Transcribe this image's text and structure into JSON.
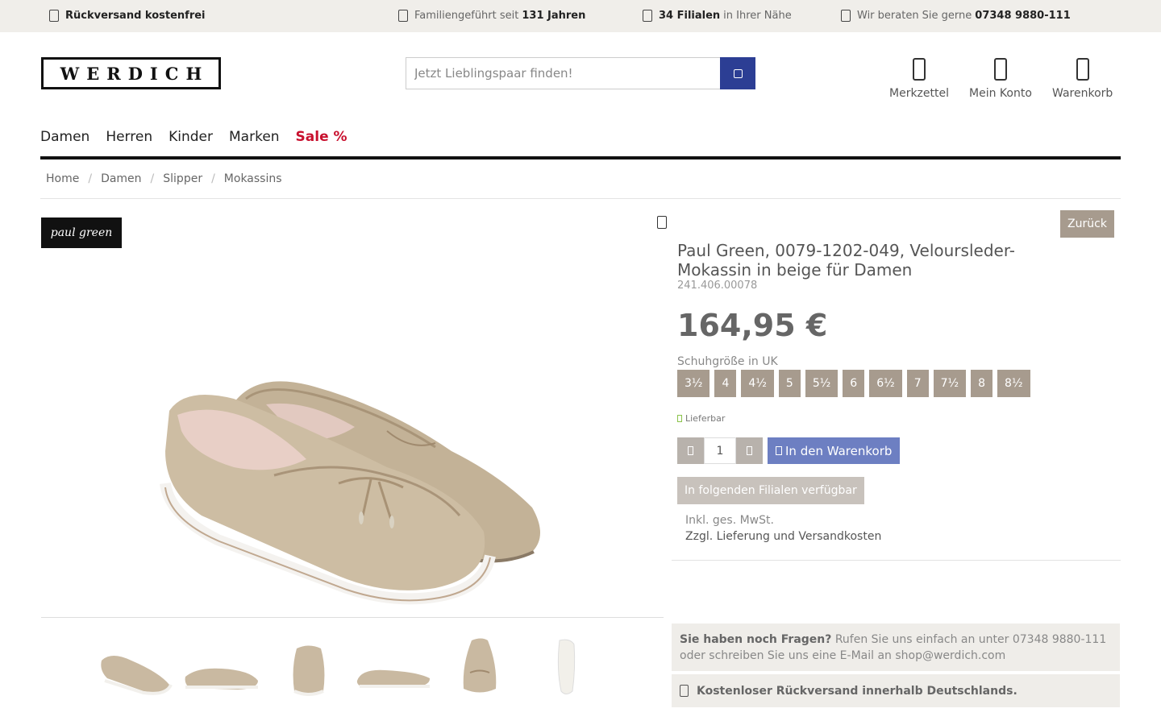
{
  "topbar": {
    "items": [
      {
        "icon": "box-icon",
        "pre": "",
        "bold": "Rückversand kostenfrei",
        "post": ""
      },
      {
        "icon": "home-icon",
        "pre": "Familiengeführt seit ",
        "bold": "131 Jahren",
        "post": ""
      },
      {
        "icon": "map-pin-icon",
        "pre": "",
        "bold": "34 Filialen",
        "post": " in Ihrer Nähe"
      },
      {
        "icon": "phone-icon",
        "pre": "Wir beraten Sie gerne ",
        "bold": "07348 9880-111",
        "post": ""
      }
    ]
  },
  "header": {
    "logo": "WERDICH",
    "search_placeholder": "Jetzt Lieblingspaar finden!",
    "icons": [
      {
        "name": "merkzettel",
        "label": "Merkzettel",
        "icon": "heart-icon"
      },
      {
        "name": "mein-konto",
        "label": "Mein Konto",
        "icon": "user-icon"
      },
      {
        "name": "warenkorb",
        "label": "Warenkorb",
        "icon": "cart-icon"
      }
    ]
  },
  "nav": [
    "Damen",
    "Herren",
    "Kinder",
    "Marken"
  ],
  "nav_sale": "Sale %",
  "colors": {
    "sale": "#c8102e",
    "search_button": "#2c3e94",
    "size_button": "#a79b8e",
    "cart_button": "#6d7fc2",
    "shoe": "#c9b9a1"
  },
  "breadcrumb": [
    "Home",
    "Damen",
    "Slipper",
    "Mokassins"
  ],
  "gallery": {
    "brand_logo": "paul green",
    "thumbnails": 6
  },
  "product": {
    "back_label": "Zurück",
    "title": "Paul Green, 0079-1202-049, Veloursleder-Mokassin in beige für Damen",
    "sku": "241.406.00078",
    "price": "164,95 €",
    "size_label": "Schuhgröße in UK",
    "sizes": [
      "3½",
      "4",
      "4½",
      "5",
      "5½",
      "6",
      "6½",
      "7",
      "7½",
      "8",
      "8½"
    ],
    "availability": "Lieferbar",
    "quantity": "1",
    "add_to_cart": "In den Warenkorb",
    "stores_button": "In folgenden Filialen verfügbar",
    "tax_note": "Inkl. ges. MwSt.",
    "shipping_note": "Zzgl. Lieferung und Versandkosten"
  },
  "info": {
    "question_bold": "Sie haben noch Fragen?",
    "question_text": " Rufen Sie uns einfach an unter 07348 9880-111 oder schreiben Sie uns eine E-Mail an shop@werdich.com",
    "return_text": "Kostenloser Rückversand innerhalb Deutschlands."
  }
}
